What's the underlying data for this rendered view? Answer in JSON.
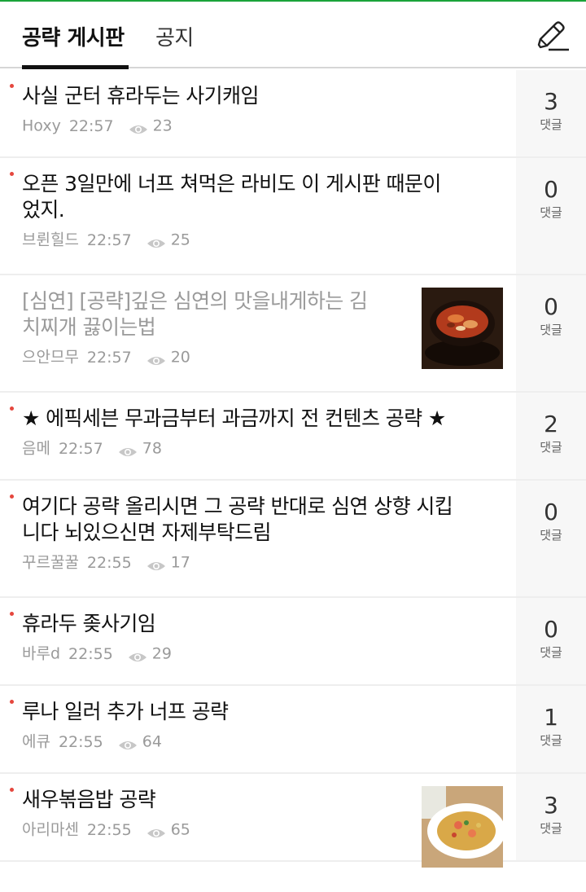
{
  "tabs": [
    {
      "label": "공략 게시판",
      "active": true
    },
    {
      "label": "공지",
      "active": false
    }
  ],
  "write_icon": "pencil-icon",
  "colors": {
    "accent_line": "#1aa33a",
    "new_dot": "#e5473e",
    "comment_bg": "#f7f7f7"
  },
  "comment_label": "댓글",
  "posts": [
    {
      "title_lines": [
        "사실 군터 휴라두는 사기캐임"
      ],
      "author": "Hoxy",
      "time": "22:57",
      "views": "23",
      "comments": "3",
      "read": false,
      "thumb": null
    },
    {
      "title_lines": [
        "오픈 3일만에 너프 쳐먹은 라비도 이 게시판 때문이",
        "었지."
      ],
      "author": "브륀힐드",
      "time": "22:57",
      "views": "25",
      "comments": "0",
      "read": false,
      "thumb": null
    },
    {
      "title_lines": [
        "[심연] [공략]깊은 심연의 맛을내게하는 김",
        "치찌개 끓이는법"
      ],
      "author": "으안므무",
      "time": "22:57",
      "views": "20",
      "comments": "0",
      "read": true,
      "thumb": "kimchi-stew"
    },
    {
      "title_lines": [
        "★ 에픽세븐 무과금부터 과금까지 전 컨텐츠 공략 ★"
      ],
      "author": "음메",
      "time": "22:57",
      "views": "78",
      "comments": "2",
      "read": false,
      "thumb": null
    },
    {
      "title_lines": [
        "여기다 공략 올리시면 그 공략 반대로 심연 상향 시킵",
        "니다 뇌있으신면 자제부탁드림"
      ],
      "author": "꾸르꿀꿀",
      "time": "22:55",
      "views": "17",
      "comments": "0",
      "read": false,
      "thumb": null
    },
    {
      "title_lines": [
        "휴라두 좆사기임"
      ],
      "author": "바루d",
      "time": "22:55",
      "views": "29",
      "comments": "0",
      "read": false,
      "thumb": null
    },
    {
      "title_lines": [
        "루나 일러 추가 너프 공략"
      ],
      "author": "에큐",
      "time": "22:55",
      "views": "64",
      "comments": "1",
      "read": false,
      "thumb": null
    },
    {
      "title_lines": [
        "새우볶음밥 공략"
      ],
      "author": "아리마센",
      "time": "22:55",
      "views": "65",
      "comments": "3",
      "read": false,
      "thumb": "shrimp-fried-rice"
    }
  ]
}
